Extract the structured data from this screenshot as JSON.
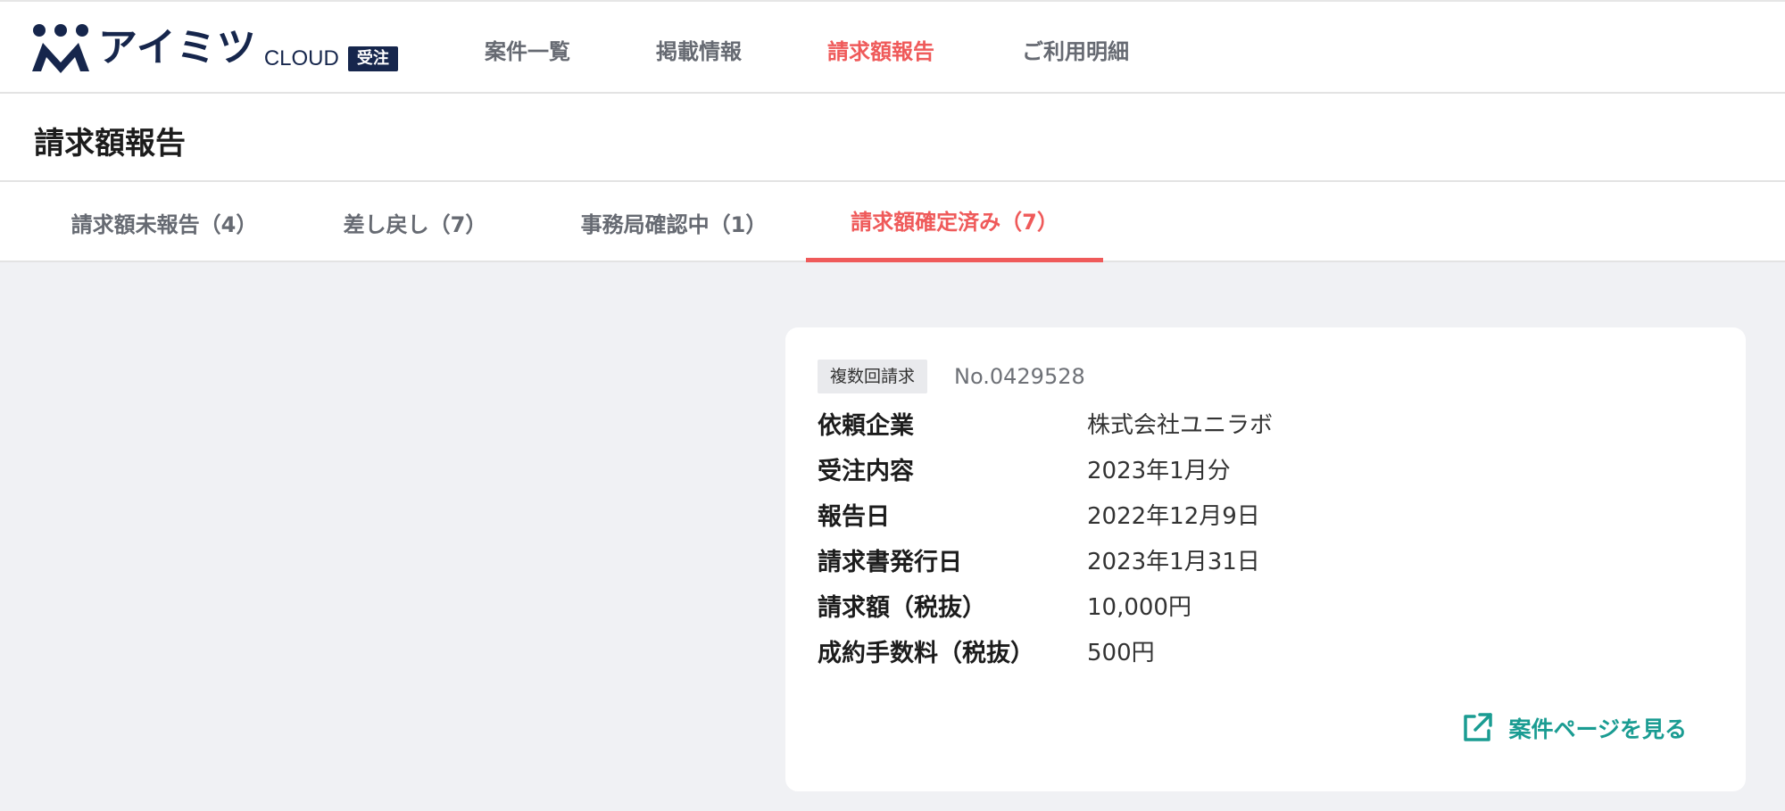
{
  "app": {
    "logo_text": "アイミツ",
    "logo_cloud": "CLOUD",
    "logo_badge": "受注"
  },
  "nav": {
    "items": [
      {
        "label": "案件一覧",
        "active": false
      },
      {
        "label": "掲載情報",
        "active": false
      },
      {
        "label": "請求額報告",
        "active": true
      },
      {
        "label": "ご利用明細",
        "active": false
      }
    ]
  },
  "page": {
    "title": "請求額報告"
  },
  "tabs": [
    {
      "label": "請求額未報告（4）",
      "active": false
    },
    {
      "label": "差し戻し（7）",
      "active": false
    },
    {
      "label": "事務局確認中（1）",
      "active": false
    },
    {
      "label": "請求額確定済み（7）",
      "active": true
    }
  ],
  "card": {
    "tag": "複数回請求",
    "case_no": "No.0429528",
    "rows": [
      {
        "label": "依頼企業",
        "value": "株式会社ユニラボ"
      },
      {
        "label": "受注内容",
        "value": "2023年1月分"
      },
      {
        "label": "報告日",
        "value": "2022年12月9日"
      },
      {
        "label": "請求書発行日",
        "value": "2023年1月31日"
      },
      {
        "label": "請求額（税抜）",
        "value": "10,000円"
      },
      {
        "label": "成約手数料（税抜）",
        "value": "500円"
      }
    ],
    "link_label": "案件ページを見る"
  },
  "colors": {
    "accent": "#ef5a5a",
    "brand": "#16264c",
    "link": "#1a9c92",
    "background": "#f0f1f4"
  },
  "icons": {
    "logo": "aimitsu-logo-icon",
    "external_link": "external-link-icon"
  }
}
